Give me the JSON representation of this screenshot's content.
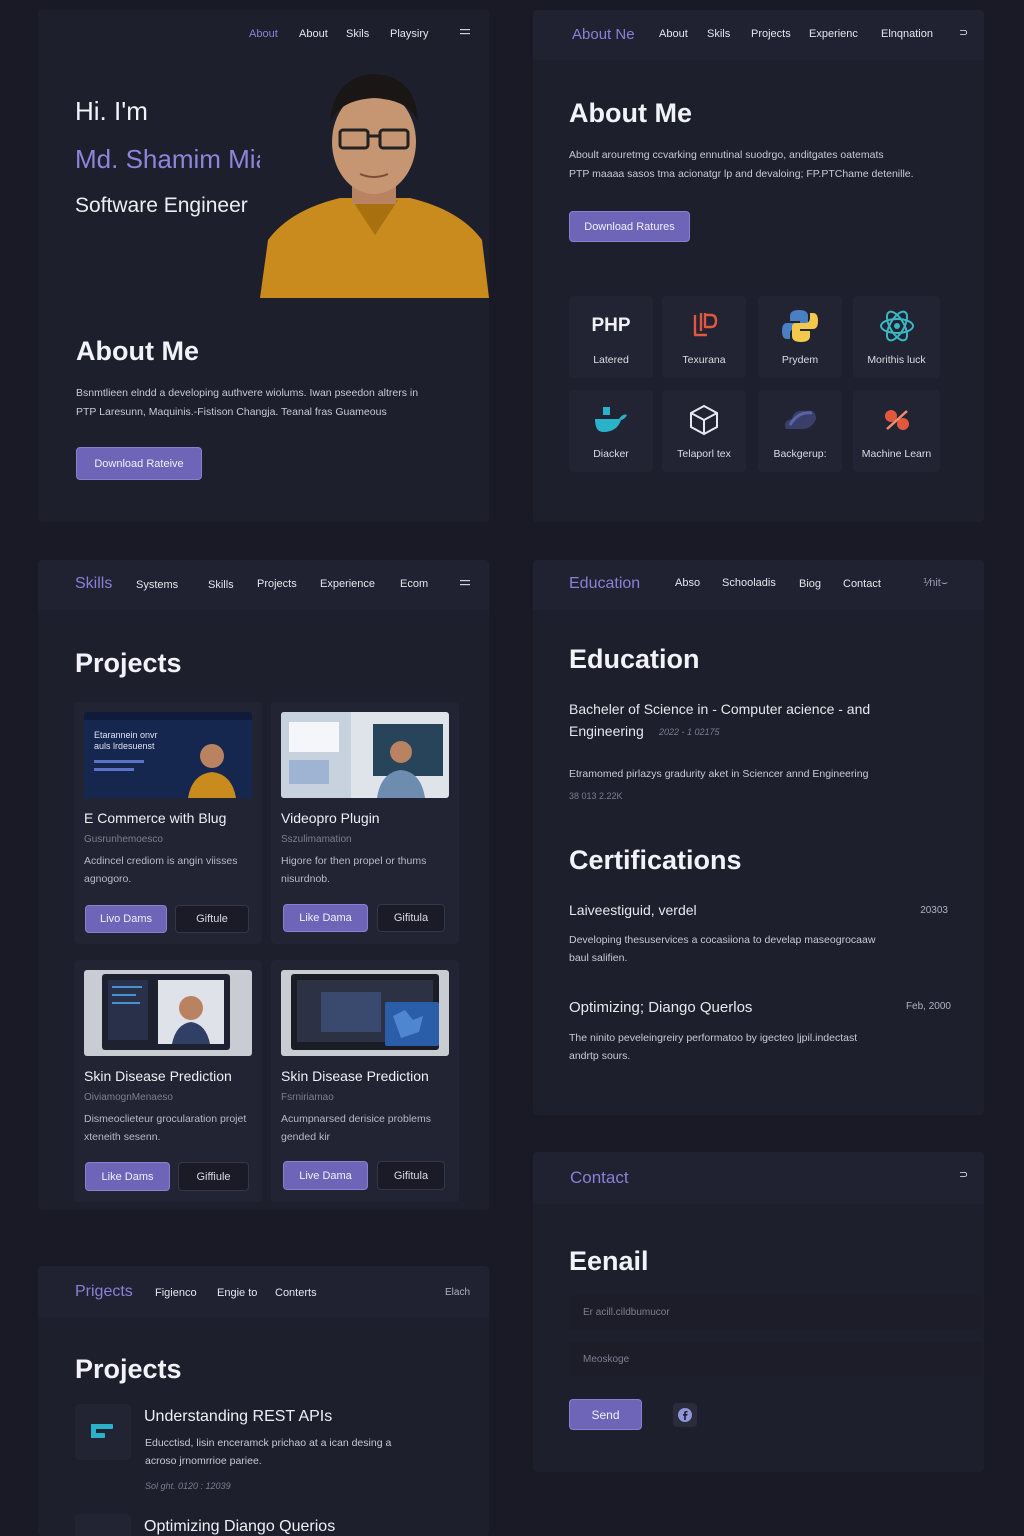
{
  "panel1": {
    "nav": [
      "About",
      "About",
      "Skils",
      "Playsiry"
    ],
    "greeting": "Hi. I'm",
    "name": "Md. Shamim Miah",
    "role": "Software Engineer",
    "about_title": "About Me",
    "about_text_1": "Bsnmtlieen elndd a developing authvere wiolums. Iwan pseedon altrers in",
    "about_text_2": "PTP Laresunn, Maquinis.-Fistison Changja. Teanal fras Guameous",
    "download_button": "Download Rateive"
  },
  "panel2": {
    "brand": "About Ne",
    "nav": [
      "About",
      "Skils",
      "Projects",
      "Experienc",
      "Elnqnation"
    ],
    "nav_right": "⊃",
    "title": "About Me",
    "text_1": "Aboult arouretmg ccvarking ennutinal suodrgo, anditgates oatemats",
    "text_2": "PTP maaaa sasos tma acionatgr lp and devaloing; FP.PTChame detenille.",
    "download_button": "Download Ratures",
    "skills": [
      {
        "label": "Latered",
        "icon": "php-icon",
        "text": "PHP"
      },
      {
        "label": "Texurana",
        "icon": "laravel-icon"
      },
      {
        "label": "Prydem",
        "icon": "python-icon"
      },
      {
        "label": "Morithis luck",
        "icon": "react-icon"
      },
      {
        "label": "Diacker",
        "icon": "docker-icon"
      },
      {
        "label": "Telaporl tex",
        "icon": "cube-icon"
      },
      {
        "label": "Backgerup:",
        "icon": "cloud-icon"
      },
      {
        "label": "Machine Learn",
        "icon": "ml-icon"
      }
    ]
  },
  "panel3": {
    "brand": "Skills",
    "nav": [
      "Systems",
      "Skills",
      "Projects",
      "Experience",
      "Ecom"
    ],
    "title": "Projects",
    "thumb_text_1": "Etarannein onvr",
    "thumb_text_2": "auls lrdesuenst",
    "cards": [
      {
        "title": "E Commerce with Blug",
        "sub": "Gusrunhemoesco",
        "desc": "Acdincel crediom is angin viisses agnogoro.",
        "primary": "Livo Dams",
        "secondary": "Giftule"
      },
      {
        "title": "Videopro Plugin",
        "sub": "Sszulimamation",
        "desc": "Higore for then propel or thums nisurdnob.",
        "primary": "Like Dama",
        "secondary": "Gifitula"
      },
      {
        "title": "Skin Disease Prediction",
        "sub": "OiviamognMenaeso",
        "desc": "Dismeoclieteur grocularation projet xteneith sesenn.",
        "primary": "Like Dams",
        "secondary": "Giffiule"
      },
      {
        "title": "Skin Disease Prediction",
        "sub": "Fsrniriamao",
        "desc": "Acumpnarsed derisice problems gended kir",
        "primary": "Live Dama",
        "secondary": "Gifitula"
      }
    ]
  },
  "panel4": {
    "brand": "Education",
    "nav": [
      "Abso",
      "Schooladis",
      "Biog",
      "Contact"
    ],
    "nav_right": "⅟nit⌣",
    "title": "Education",
    "degree_1": "Bacheler of Science in - Computer acience - and",
    "degree_2": "Engineering",
    "degree_date": "2022 - 1 02175",
    "edu_text": "Etramomed pirlazys gradurity aket in Sciencer annd Engineering",
    "edu_sub": "38 013 2.22K",
    "cert_title": "Certifications",
    "certs": [
      {
        "name": "Laiveestiguid, verdel",
        "date": "20303",
        "desc_1": "Developing thesuservices a cocasiiona to develap maseogrocaaw",
        "desc_2": "baul salifien."
      },
      {
        "name": "Optimizing; Diango Querlos",
        "date": "Feb, 2000",
        "desc_1": "The ninito peveleingreiry performatoo by igecteo |jpil.indectast",
        "desc_2": "andrtp sours."
      }
    ]
  },
  "panel5": {
    "brand": "Prigects",
    "nav": [
      "Figienco",
      "Engie to",
      "Conterts"
    ],
    "nav_right": "Elach",
    "title": "Projects",
    "items": [
      {
        "title": "Understanding REST APIs",
        "desc_1": "Educctisd, lisin enceramck prichao at a ican desing a",
        "desc_2": "acroso jrnomrrioe pariee.",
        "meta": "Sol ght. 0120 : 12039"
      },
      {
        "title": "Optimizing Diango Querios"
      }
    ]
  },
  "panel6": {
    "brand": "Contact",
    "nav_right": "⊃",
    "title": "Eenail",
    "email_placeholder": "Er acill.cildbumucor",
    "message_placeholder": "Meoskoge",
    "send_button": "Send"
  },
  "colors": {
    "accent": "#8e84dc",
    "button": "#6e64b8",
    "panel": "#1e1f2c",
    "bg": "#191a26"
  }
}
